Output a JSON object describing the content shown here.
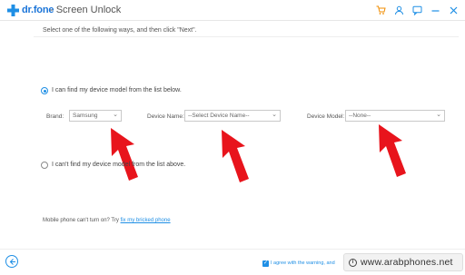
{
  "header": {
    "brand": "dr.fone",
    "title": "- Screen Unlock",
    "icons": [
      "cart-icon",
      "user-icon",
      "feedback-icon",
      "minimize-icon",
      "close-icon"
    ]
  },
  "instruction": "Select one of the following ways, and then click \"Next\".",
  "option_find": "I can find my device model from the list below.",
  "option_cant_find": "I can't find my device model from the list above.",
  "fields": {
    "brand_label": "Brand:",
    "brand_value": "Samsung",
    "device_name_label": "Device Name:",
    "device_name_value": "--Select Device Name--",
    "device_model_label": "Device Model:",
    "device_model_value": "--None--"
  },
  "help": {
    "text": "Mobile phone can't turn on? Try",
    "link": "fix my bricked phone"
  },
  "agree_text": "I agree with the warning, and",
  "watermark": "www.arabphones.net",
  "colors": {
    "accent": "#1f8fe5",
    "arrow": "#e8141c",
    "cart": "#f08c00"
  }
}
